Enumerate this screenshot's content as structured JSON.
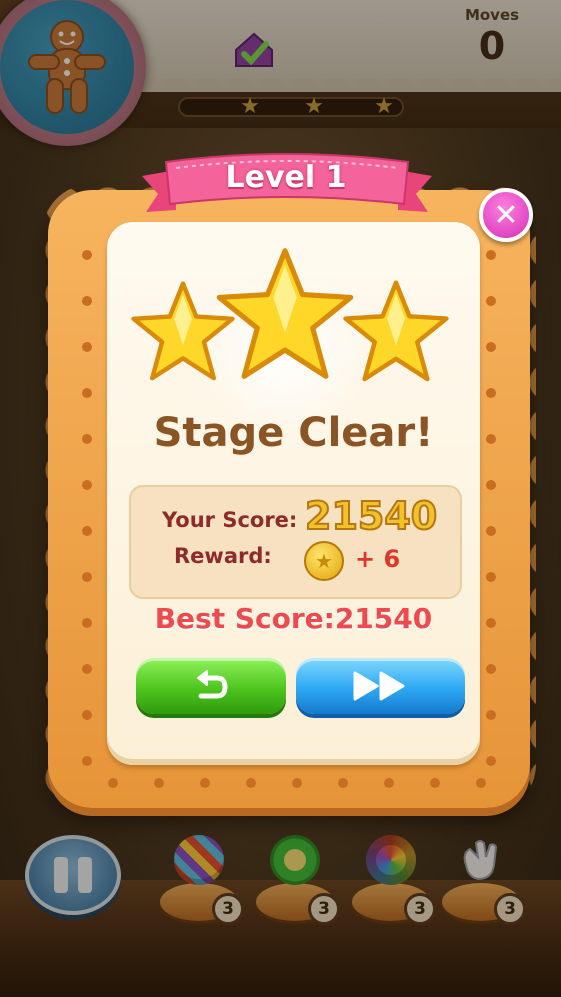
{
  "hud": {
    "moves_label": "Moves",
    "moves_value": "0",
    "progress_fraction": 0.0,
    "progress_stars": 3
  },
  "dialog": {
    "level_title": "Level 1",
    "stars_earned": 3,
    "stars_total": 3,
    "headline": "Stage Clear!",
    "score_label": "Your Score:",
    "score_value": "21540",
    "reward_label": "Reward:",
    "reward_value": "+ 6",
    "best_score_text": "Best Score:21540",
    "close_icon": "close-x-icon",
    "retry_icon": "undo-arrow-icon",
    "next_icon": "fast-forward-icon"
  },
  "boosters": [
    {
      "icon": "striped-candy-icon",
      "count": "3"
    },
    {
      "icon": "shuffle-candy-icon",
      "count": "3"
    },
    {
      "icon": "rainbow-donut-icon",
      "count": "3"
    },
    {
      "icon": "glove-hand-icon",
      "count": "3"
    }
  ],
  "colors": {
    "close_button": "#e13fbf",
    "retry_button": "#4ec51e",
    "next_button": "#2ea8f2",
    "best_score": "#ef4a4e",
    "ribbon": "#f25a8c"
  }
}
